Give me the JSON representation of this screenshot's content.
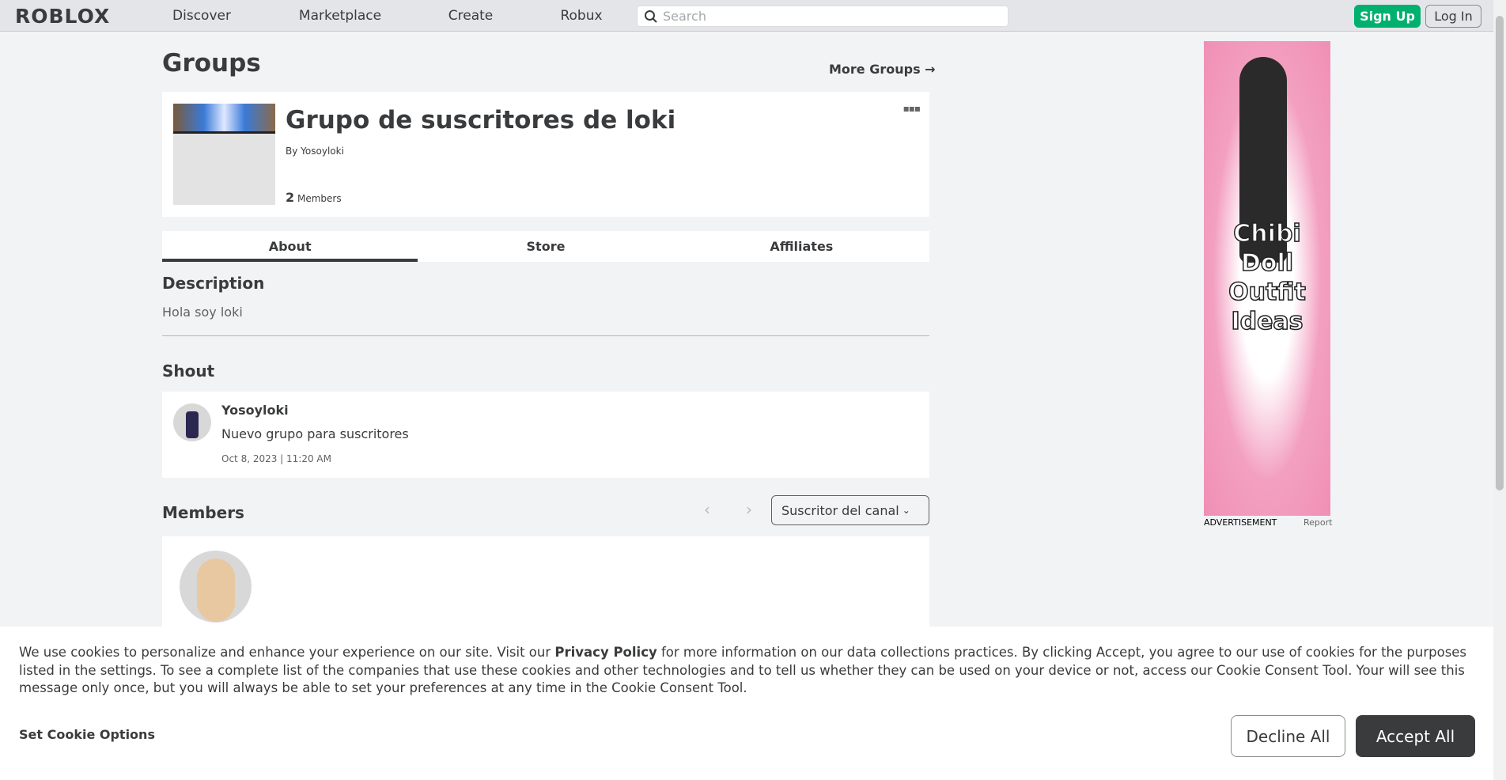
{
  "nav": {
    "logo": "ROBLOX",
    "links": [
      "Discover",
      "Marketplace",
      "Create",
      "Robux"
    ],
    "search_placeholder": "Search",
    "signup": "Sign Up",
    "login": "Log In"
  },
  "page": {
    "title": "Groups",
    "more_groups": "More Groups →"
  },
  "group": {
    "name": "Grupo de suscritores de loki",
    "by_label": "By",
    "owner": "Yosoyloki",
    "member_count": "2",
    "members_label": "Members",
    "menu": "▪▪▪"
  },
  "tabs": [
    "About",
    "Store",
    "Affiliates"
  ],
  "description": {
    "heading": "Description",
    "text": "Hola soy loki"
  },
  "shout": {
    "heading": "Shout",
    "user": "Yosoyloki",
    "text": "Nuevo grupo para suscritores",
    "date": "Oct 8, 2023 | 11:20 AM"
  },
  "members": {
    "heading": "Members",
    "prev": "‹",
    "next": "›",
    "role": "Suscritor del canal",
    "role_chevron": "⌄"
  },
  "ad": {
    "text": "Chibi Doll Outfit Ideas",
    "label": "ADVERTISEMENT",
    "report": "Report"
  },
  "cookie": {
    "text_1": "We use cookies to personalize and enhance your experience on our site. Visit our ",
    "privacy_link": "Privacy Policy",
    "text_2": " for more information on our data collections practices. By clicking Accept, you agree to our use of cookies for the purposes listed in the settings. To see a complete list of the companies that use these cookies and other technologies and to tell us whether they can be used on your device or not, access our Cookie Consent Tool. Your will see this message only once, but you will always be able to set your preferences at any time in the Cookie Consent Tool.",
    "set_options": "Set Cookie Options",
    "decline": "Decline All",
    "accept": "Accept All"
  }
}
